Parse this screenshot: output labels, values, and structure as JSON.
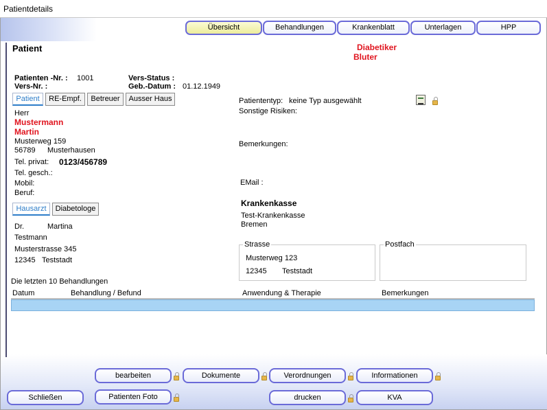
{
  "window": {
    "title": "Patientdetails"
  },
  "tabs": [
    {
      "label": "Übersicht"
    },
    {
      "label": "Behandlungen"
    },
    {
      "label": "Krankenblatt"
    },
    {
      "label": "Unterlagen"
    },
    {
      "label": "HPP"
    }
  ],
  "patient": {
    "section_title": "Patient",
    "flags": [
      "Diabetiker",
      "Bluter"
    ],
    "nr_label": "Patienten -Nr. :",
    "nr_value": "1001",
    "vers_nr_label": "Vers-Nr. :",
    "vers_status_label": "Vers-Status :",
    "geb_label": "Geb.-Datum :",
    "geb_value": "01.12.1949",
    "sub_tabs": [
      "Patient",
      "RE-Empf.",
      "Betreuer",
      "Ausser Haus"
    ],
    "salutation": "Herr",
    "lastname": "Mustermann",
    "firstname": "Martin",
    "street": "Musterweg 159",
    "zip": "56789",
    "city": "Musterhausen",
    "tel_privat_label": "Tel. privat:",
    "tel_privat_value": "0123/456789",
    "tel_gesch_label": "Tel. gesch.:",
    "mobil_label": "Mobil:",
    "beruf_label": "Beruf:"
  },
  "doctor": {
    "sub_tabs": [
      "Hausarzt",
      "Diabetologe"
    ],
    "title": "Dr.",
    "firstname": "Martina",
    "lastname": "Testmann",
    "street": "Musterstrasse 345",
    "zip": "12345",
    "city": "Teststadt"
  },
  "right": {
    "patiententyp_label": "Patiententyp:",
    "patiententyp_value": "keine Typ ausgewählt",
    "risiken_label": "Sonstige Risiken:",
    "bemerkungen_label": "Bemerkungen:",
    "email_label": "EMail :",
    "kasse_heading": "Krankenkasse",
    "kasse_name": "Test-Krankenkasse",
    "kasse_city": "Bremen",
    "strasse_legend": "Strasse",
    "strasse_value": "Musterweg 123",
    "strasse_zip": "12345",
    "strasse_city": "Teststadt",
    "postfach_legend": "Postfach"
  },
  "treatments": {
    "caption": "Die letzten 10 Behandlungen",
    "columns": [
      "Datum",
      "Behandlung / Befund",
      "Anwendung & Therapie",
      "Bemerkungen"
    ]
  },
  "buttons": {
    "bearbeiten": "bearbeiten",
    "dokumente": "Dokumente",
    "verordnungen": "Verordnungen",
    "informationen": "Informationen",
    "schliessen": "Schließen",
    "patienten_foto": "Patienten Foto",
    "drucken": "drucken",
    "kva": "KVA"
  },
  "colors": {
    "accent_border": "#6a6ad8",
    "flag_red": "#e0141e",
    "link_blue": "#2d7dc9",
    "row_highlight": "#a8d4f5"
  },
  "icons": [
    "lock-icon",
    "document-edit-icon"
  ]
}
